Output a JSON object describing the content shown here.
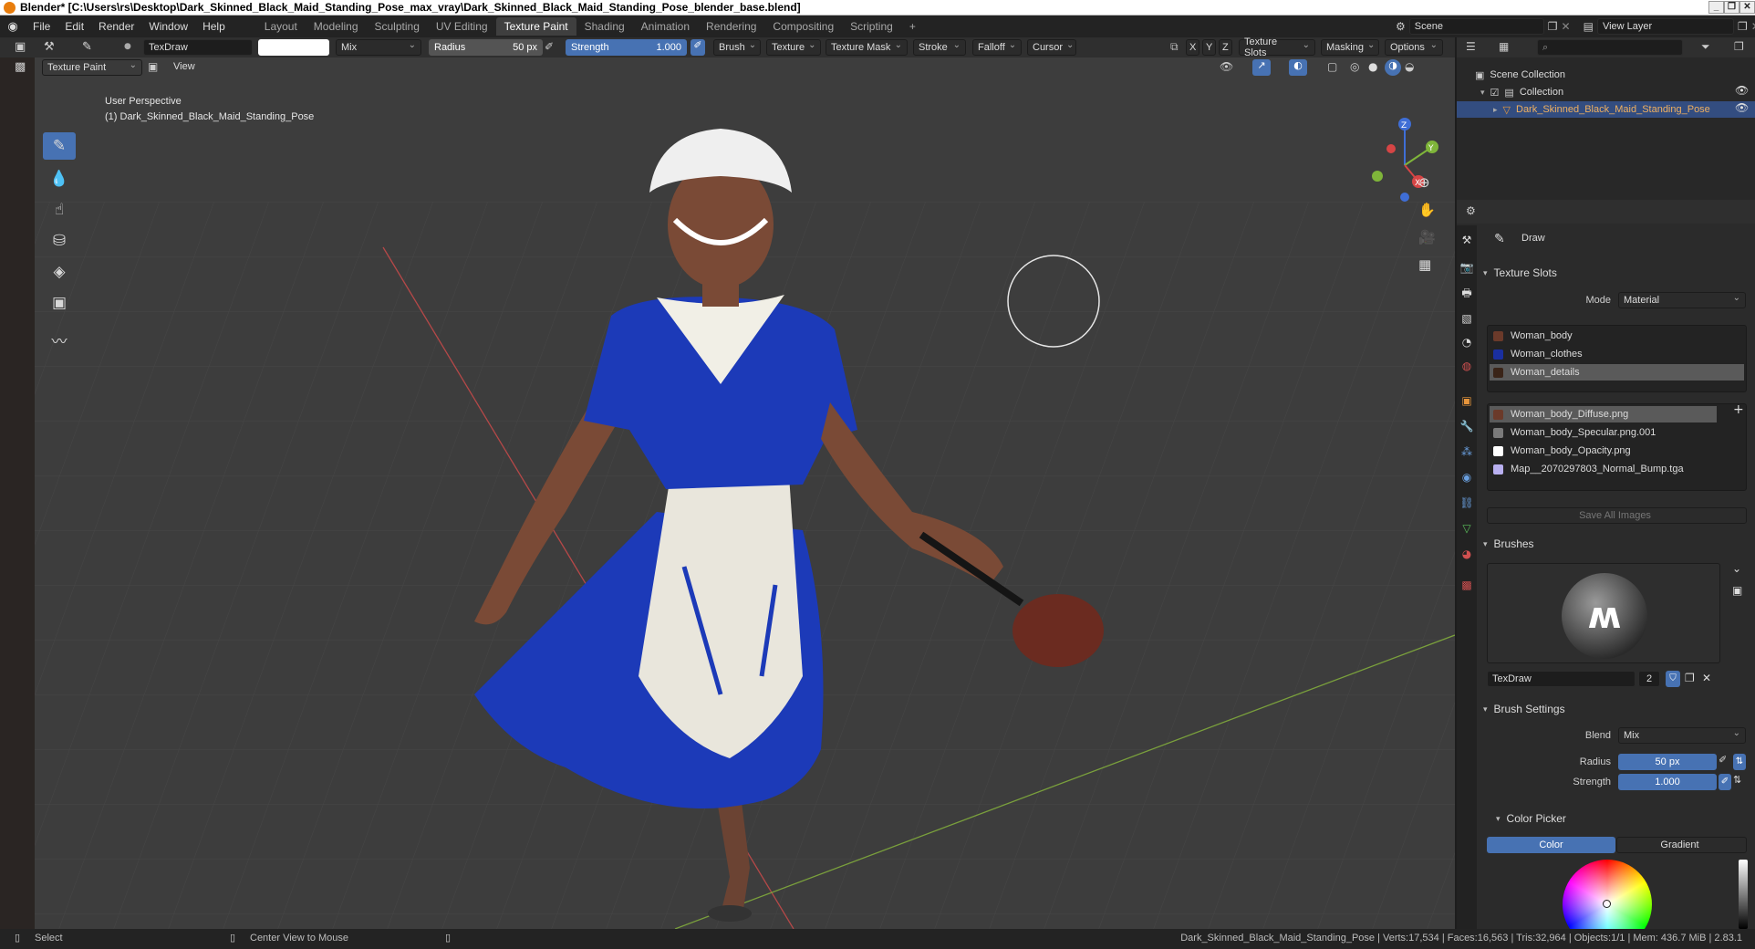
{
  "window_title": "Blender* [C:\\Users\\rs\\Desktop\\Dark_Skinned_Black_Maid_Standing_Pose_max_vray\\Dark_Skinned_Black_Maid_Standing_Pose_blender_base.blend]",
  "menus": [
    "File",
    "Edit",
    "Render",
    "Window",
    "Help"
  ],
  "workspaces": [
    "Layout",
    "Modeling",
    "Sculpting",
    "UV Editing",
    "Texture Paint",
    "Shading",
    "Animation",
    "Rendering",
    "Compositing",
    "Scripting"
  ],
  "active_workspace": "Texture Paint",
  "scene": "Scene",
  "view_layer": "View Layer",
  "tool_header": {
    "brush_name": "TexDraw",
    "blend": "Mix",
    "radius_label": "Radius",
    "radius_value": "50 px",
    "strength_label": "Strength",
    "strength_value": "1.000",
    "dropdowns": [
      "Brush",
      "Texture",
      "Texture Mask",
      "Stroke",
      "Falloff",
      "Cursor"
    ],
    "axes": [
      "X",
      "Y",
      "Z"
    ],
    "right_dropdowns": [
      "Texture Slots",
      "Masking",
      "Options"
    ]
  },
  "viewport_header": {
    "mode": "Texture Paint",
    "view": "View"
  },
  "viewport": {
    "perspective": "User Perspective",
    "object_label": "(1) Dark_Skinned_Black_Maid_Standing_Pose",
    "gizmo": {
      "x": "X",
      "y": "Y",
      "z": "Z"
    }
  },
  "outliner": {
    "scene_collection": "Scene Collection",
    "collection": "Collection",
    "object": "Dark_Skinned_Black_Maid_Standing_Pose"
  },
  "properties": {
    "tool_name": "Draw",
    "texture_slots": {
      "title": "Texture Slots",
      "mode_label": "Mode",
      "mode_value": "Material",
      "materials": [
        {
          "name": "Woman_body",
          "color": "#6b3a2a"
        },
        {
          "name": "Woman_clothes",
          "color": "#1a2fa0"
        },
        {
          "name": "Woman_details",
          "color": "#3a2418"
        }
      ],
      "selected_material": 2,
      "images": [
        {
          "name": "Woman_body_Diffuse.png",
          "color": "#6b3a2a"
        },
        {
          "name": "Woman_body_Specular.png.001",
          "color": "#7a7a7a"
        },
        {
          "name": "Woman_body_Opacity.png",
          "color": "#ffffff"
        },
        {
          "name": "Map__2070297803_Normal_Bump.tga",
          "color": "#b9b0f0"
        }
      ],
      "selected_image": 0,
      "save_all": "Save All Images"
    },
    "brushes": {
      "title": "Brushes",
      "name": "TexDraw",
      "users": "2"
    },
    "brush_settings": {
      "title": "Brush Settings",
      "blend_label": "Blend",
      "blend_value": "Mix",
      "radius_label": "Radius",
      "radius_value": "50 px",
      "strength_label": "Strength",
      "strength_value": "1.000"
    },
    "color_picker": {
      "title": "Color Picker",
      "tabs": [
        "Color",
        "Gradient"
      ]
    }
  },
  "status": {
    "left": "Select",
    "middle": "Center View to Mouse",
    "right": "Dark_Skinned_Black_Maid_Standing_Pose | Verts:17,534 | Faces:16,563 | Tris:32,964 | Objects:1/1 | Mem: 436.7 MiB | 2.83.1"
  },
  "colors": {
    "accent": "#4772b3",
    "brush_color": "#ffffff",
    "dress_blue": "#1c3ab8"
  }
}
